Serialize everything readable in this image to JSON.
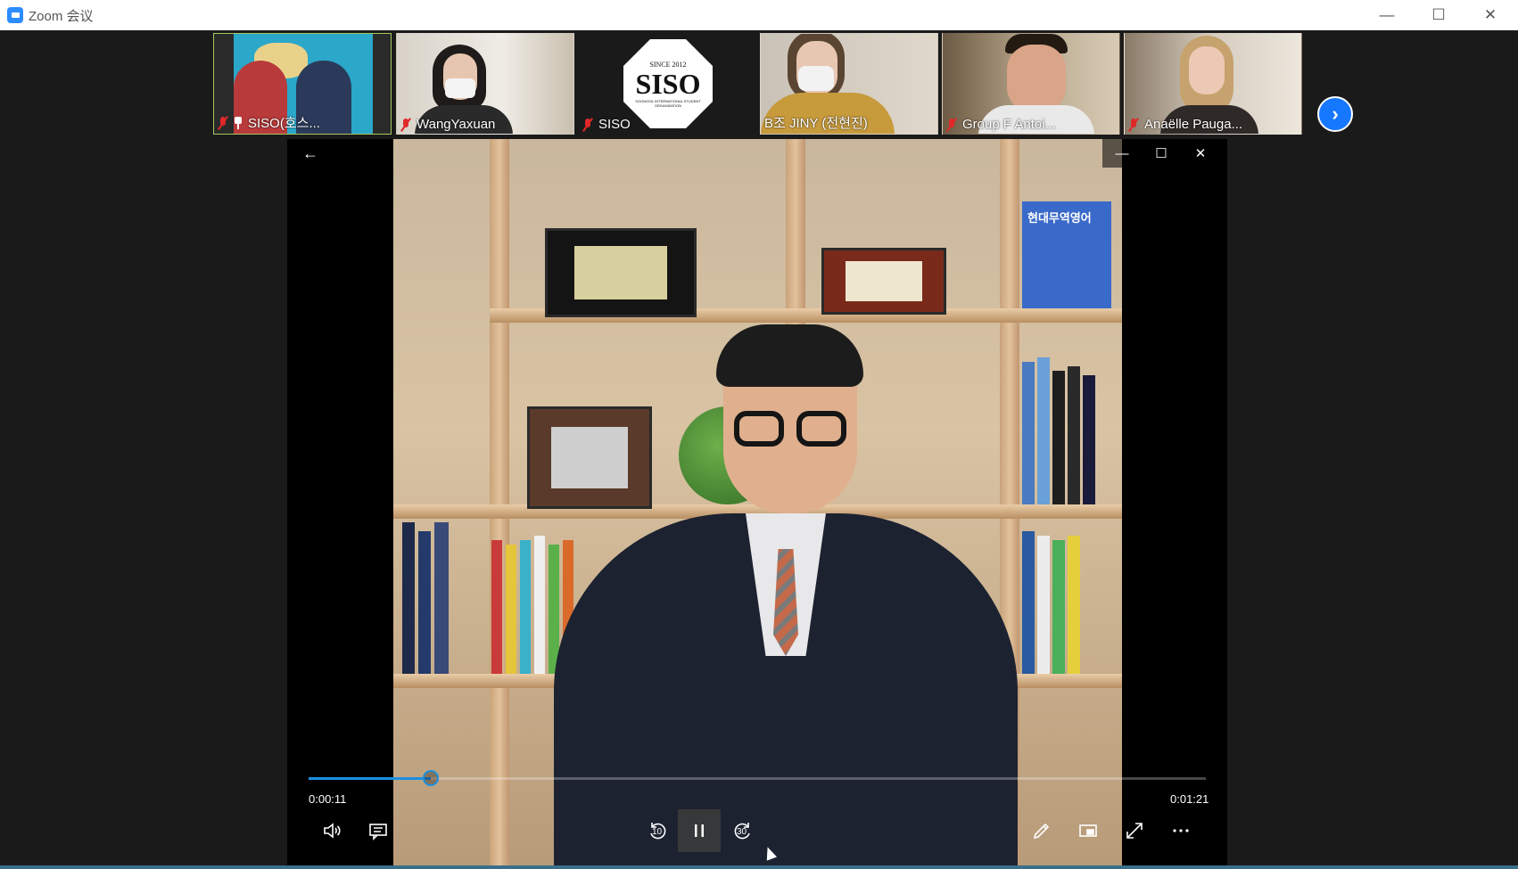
{
  "window": {
    "title": "Zoom 会议",
    "minimize_glyph": "—",
    "maximize_glyph": "☐",
    "close_glyph": "✕"
  },
  "participants": [
    {
      "name": "SISO(호스...",
      "muted": true,
      "pinned": true,
      "active": true
    },
    {
      "name": "WangYaxuan",
      "muted": true,
      "pinned": false,
      "active": false
    },
    {
      "name": "SISO",
      "muted": true,
      "pinned": false,
      "active": false
    },
    {
      "name": "B조 JINY (전현진)",
      "muted": false,
      "pinned": false,
      "active": false
    },
    {
      "name": "Group F Antoi...",
      "muted": true,
      "pinned": false,
      "active": false
    },
    {
      "name": "Anaëlle Pauga...",
      "muted": true,
      "pinned": false,
      "active": false
    }
  ],
  "siso_logo": {
    "top": "SINCE 2012",
    "main": "SISO",
    "sub": "SOONGSIL INTERNATIONAL STUDENT ORGANIZATION"
  },
  "next_page_icon": "chevron-right-icon",
  "player": {
    "back_glyph": "←",
    "minimize_glyph": "—",
    "maximize_glyph": "☐",
    "close_glyph": "✕",
    "current_time": "0:00:11",
    "total_time": "0:01:21",
    "progress_fraction": 0.136,
    "skip_back_label": "10",
    "skip_forward_label": "30",
    "accent": "#1a8fe0"
  },
  "video_scene": {
    "book_title": "현대무역영어"
  }
}
